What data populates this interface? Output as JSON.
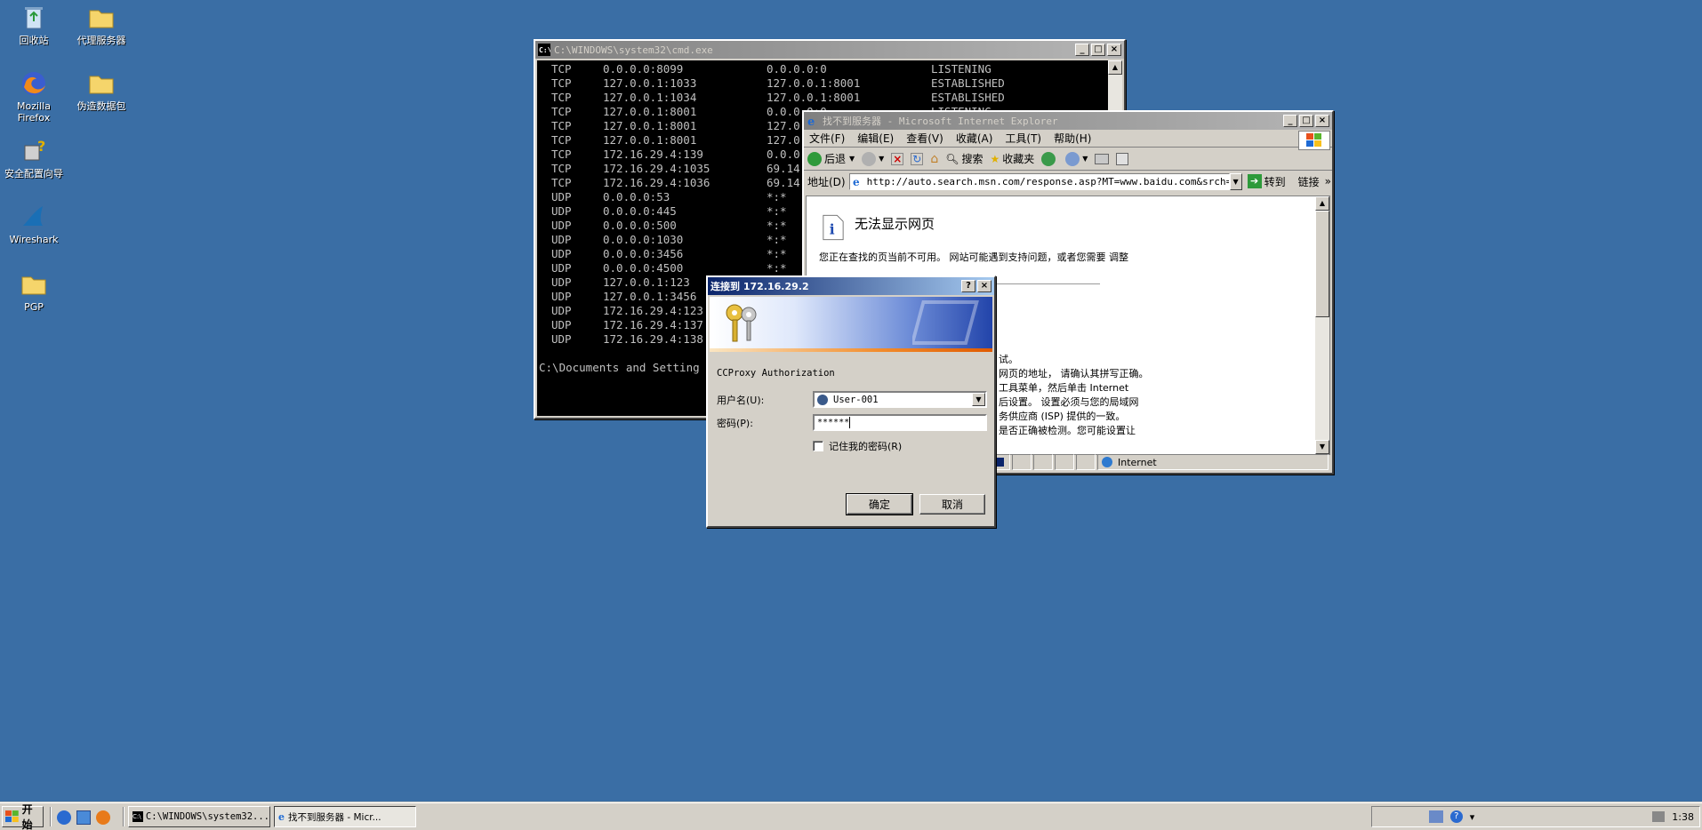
{
  "desktop": {
    "icons": [
      {
        "label": "回收站"
      },
      {
        "label": "代理服务器"
      },
      {
        "label": "Mozilla Firefox"
      },
      {
        "label": "伪造数据包"
      },
      {
        "label": "安全配置向导"
      },
      {
        "label": "Wireshark"
      },
      {
        "label": "PGP"
      }
    ]
  },
  "cmd": {
    "title": "C:\\WINDOWS\\system32\\cmd.exe",
    "rows": [
      {
        "proto": "TCP",
        "local": "0.0.0.0:8099",
        "foreign": "0.0.0.0:0",
        "state": "LISTENING"
      },
      {
        "proto": "TCP",
        "local": "127.0.0.1:1033",
        "foreign": "127.0.0.1:8001",
        "state": "ESTABLISHED"
      },
      {
        "proto": "TCP",
        "local": "127.0.0.1:1034",
        "foreign": "127.0.0.1:8001",
        "state": "ESTABLISHED"
      },
      {
        "proto": "TCP",
        "local": "127.0.0.1:8001",
        "foreign": "0.0.0.0:0",
        "state": "LISTENING"
      },
      {
        "proto": "TCP",
        "local": "127.0.0.1:8001",
        "foreign": "127.0",
        "state": ""
      },
      {
        "proto": "TCP",
        "local": "127.0.0.1:8001",
        "foreign": "127.0",
        "state": ""
      },
      {
        "proto": "TCP",
        "local": "172.16.29.4:139",
        "foreign": "0.0.0",
        "state": ""
      },
      {
        "proto": "TCP",
        "local": "172.16.29.4:1035",
        "foreign": "69.14",
        "state": ""
      },
      {
        "proto": "TCP",
        "local": "172.16.29.4:1036",
        "foreign": "69.14",
        "state": ""
      },
      {
        "proto": "UDP",
        "local": "0.0.0.0:53",
        "foreign": "*:*",
        "state": ""
      },
      {
        "proto": "UDP",
        "local": "0.0.0.0:445",
        "foreign": "*:*",
        "state": ""
      },
      {
        "proto": "UDP",
        "local": "0.0.0.0:500",
        "foreign": "*:*",
        "state": ""
      },
      {
        "proto": "UDP",
        "local": "0.0.0.0:1030",
        "foreign": "*:*",
        "state": ""
      },
      {
        "proto": "UDP",
        "local": "0.0.0.0:3456",
        "foreign": "*:*",
        "state": ""
      },
      {
        "proto": "UDP",
        "local": "0.0.0.0:4500",
        "foreign": "*:*",
        "state": ""
      },
      {
        "proto": "UDP",
        "local": "127.0.0.1:123",
        "foreign": "",
        "state": ""
      },
      {
        "proto": "UDP",
        "local": "127.0.0.1:3456",
        "foreign": "",
        "state": ""
      },
      {
        "proto": "UDP",
        "local": "172.16.29.4:123",
        "foreign": "",
        "state": ""
      },
      {
        "proto": "UDP",
        "local": "172.16.29.4:137",
        "foreign": "",
        "state": ""
      },
      {
        "proto": "UDP",
        "local": "172.16.29.4:138",
        "foreign": "",
        "state": ""
      }
    ],
    "prompt": "C:\\Documents and Setting"
  },
  "ie": {
    "title": "找不到服务器 - Microsoft Internet Explorer",
    "menu": [
      "文件(F)",
      "编辑(E)",
      "查看(V)",
      "收藏(A)",
      "工具(T)",
      "帮助(H)"
    ],
    "toolbar": {
      "back": "后退",
      "search": "搜索",
      "favorites": "收藏夹"
    },
    "address_label": "地址(D)",
    "address_value": "http://auto.search.msn.com/response.asp?MT=www.baidu.com&srch=3&p",
    "go_label": "转到",
    "links_label": "链接",
    "heading": "无法显示网页",
    "intro": "您正在查找的页当前不可用。 网站可能遇到支持问题，或者您需要 调整",
    "partial_lines": [
      "试。",
      "网页的地址， 请确认其拼写正确。",
      "工具菜单，然后单击 Internet",
      "后设置。 设置必须与您的局域网",
      "务供应商 (ISP) 提供的一致。",
      "是否正确被检测。您可能设置让"
    ],
    "status_zone": "Internet"
  },
  "dialog": {
    "title": "连接到 172.16.29.2",
    "prompt": "CCProxy Authorization",
    "username_label": "用户名(U):",
    "username_value": "User-001",
    "password_label": "密码(P):",
    "password_value": "******",
    "remember_label": "记住我的密码(R)",
    "ok_label": "确定",
    "cancel_label": "取消"
  },
  "taskbar": {
    "start_label": "开始",
    "tasks": [
      {
        "label": "C:\\WINDOWS\\system32..."
      },
      {
        "label": "找不到服务器 - Micr..."
      }
    ],
    "clock": "1:38"
  }
}
